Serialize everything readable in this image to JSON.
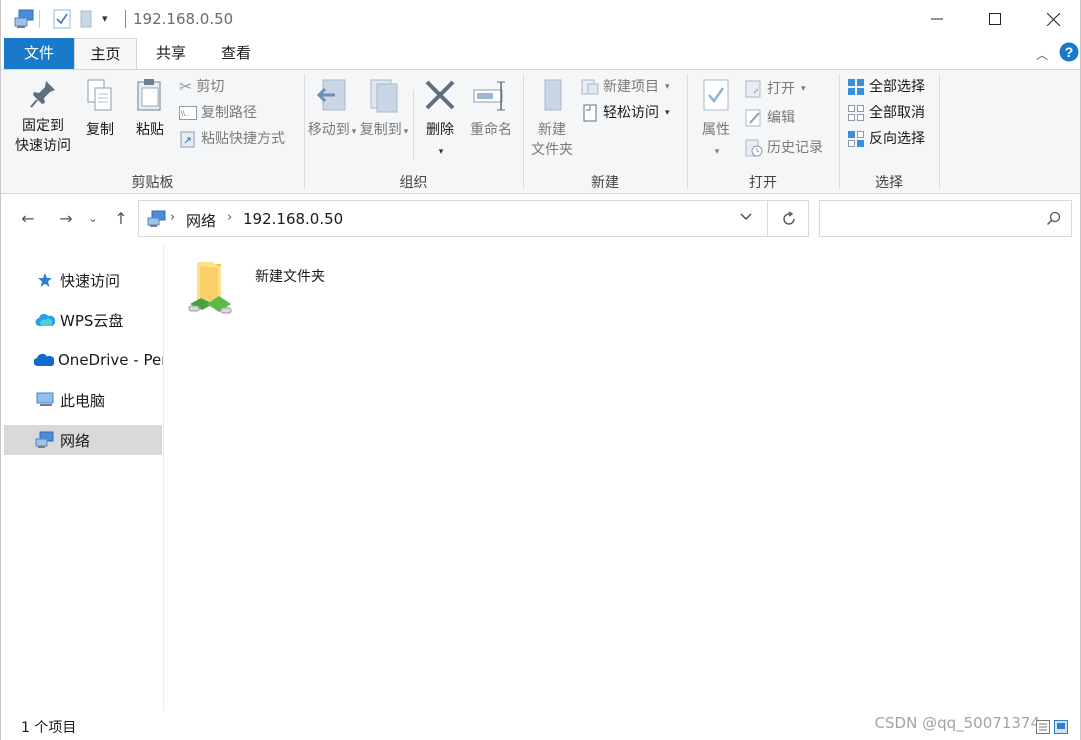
{
  "window": {
    "title": "192.168.0.50",
    "controls": {
      "minimize": "minimize",
      "maximize": "maximize",
      "close": "close"
    }
  },
  "ribbon_tabs": {
    "file": "文件",
    "home": "主页",
    "share": "共享",
    "view": "查看"
  },
  "ribbon": {
    "clipboard": {
      "label": "剪贴板",
      "pin_line1": "固定到",
      "pin_line2": "快速访问",
      "copy": "复制",
      "paste": "粘贴",
      "cut": "剪切",
      "copy_path": "复制路径",
      "paste_shortcut": "粘贴快捷方式"
    },
    "organize": {
      "label": "组织",
      "move_to": "移动到",
      "copy_to": "复制到",
      "delete": "删除",
      "rename": "重命名"
    },
    "new": {
      "label": "新建",
      "new_folder_line1": "新建",
      "new_folder_line2": "文件夹",
      "new_item": "新建项目",
      "easy_access": "轻松访问"
    },
    "open": {
      "label": "打开",
      "properties": "属性",
      "open": "打开",
      "edit": "编辑",
      "history": "历史记录"
    },
    "select": {
      "label": "选择",
      "select_all": "全部选择",
      "select_none": "全部取消",
      "invert": "反向选择"
    }
  },
  "address": {
    "crumbs": [
      "网络",
      "192.168.0.50"
    ],
    "search_placeholder": ""
  },
  "nav_pane": {
    "items": [
      {
        "label": "快速访问",
        "icon": "star-icon"
      },
      {
        "label": "WPS云盘",
        "icon": "cloud-icon"
      },
      {
        "label": "OneDrive - Per",
        "icon": "onedrive-icon"
      },
      {
        "label": "此电脑",
        "icon": "computer-icon"
      },
      {
        "label": "网络",
        "icon": "network-icon",
        "selected": true
      }
    ]
  },
  "files": [
    {
      "name": "新建文件夹",
      "icon": "shared-folder-icon"
    }
  ],
  "status": {
    "item_count": "1 个项目",
    "watermark": "CSDN @qq_50071374"
  },
  "colors": {
    "accent": "#1979ca",
    "selected": "#d9d9d9",
    "ribbon_bg": "#f5f6f7"
  }
}
